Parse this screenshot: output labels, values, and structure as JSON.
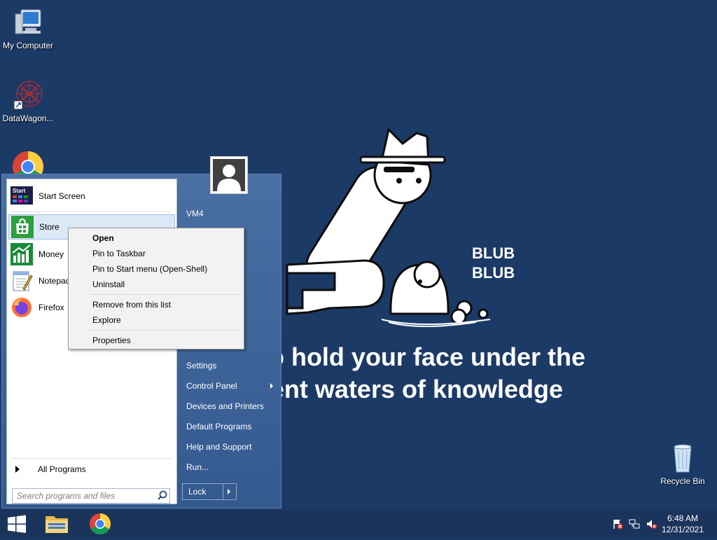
{
  "desktop": {
    "icons": [
      {
        "label": "My Computer",
        "icon": "computer-icon"
      },
      {
        "label": "DataWagon...",
        "icon": "datawagon-icon"
      },
      {
        "label": "",
        "icon": "chrome-icon"
      },
      {
        "label": "Recycle Bin",
        "icon": "recycle-bin-icon"
      }
    ],
    "wallpaper": {
      "bubble_text_1": "BLUB",
      "bubble_text_2": "BLUB",
      "caption_line_1": "Time to hold your face under the",
      "caption_line_2": "effervescent waters of knowledge"
    }
  },
  "start_menu": {
    "programs": [
      {
        "label": "Start Screen",
        "icon": "start-screen-icon"
      },
      {
        "label": "Store",
        "icon": "store-icon"
      },
      {
        "label": "Money",
        "icon": "money-icon"
      },
      {
        "label": "Notepad",
        "icon": "notepad-icon"
      },
      {
        "label": "Firefox",
        "icon": "firefox-icon"
      }
    ],
    "all_programs": "All Programs",
    "search_placeholder": "Search programs and files",
    "user_name": "VM4",
    "right_items": [
      {
        "label": "Settings"
      },
      {
        "label": "Control Panel"
      },
      {
        "label": "Devices and Printers"
      },
      {
        "label": "Default Programs"
      },
      {
        "label": "Help and Support"
      },
      {
        "label": "Run..."
      }
    ],
    "lock_label": "Lock"
  },
  "context_menu": {
    "items": [
      {
        "label": "Open",
        "bold": true
      },
      {
        "label": "Pin to Taskbar"
      },
      {
        "label": "Pin to Start menu (Open-Shell)"
      },
      {
        "label": "Uninstall"
      },
      {
        "label": "Remove from this list"
      },
      {
        "label": "Explore"
      },
      {
        "label": "Properties"
      }
    ]
  },
  "taskbar": {
    "pinned": [
      "windows-start-icon",
      "file-explorer-icon",
      "chrome-icon"
    ],
    "tray": [
      "action-center-flag-icon",
      "network-icon",
      "volume-muted-icon"
    ],
    "time": "6:48 AM",
    "date": "12/31/2021"
  },
  "colors": {
    "desktop_bg": "#1c3a66",
    "taskbar_bg": "#1b345b",
    "start_menu_bg": "#3c6298",
    "context_menu_bg": "#f2f2f2"
  }
}
